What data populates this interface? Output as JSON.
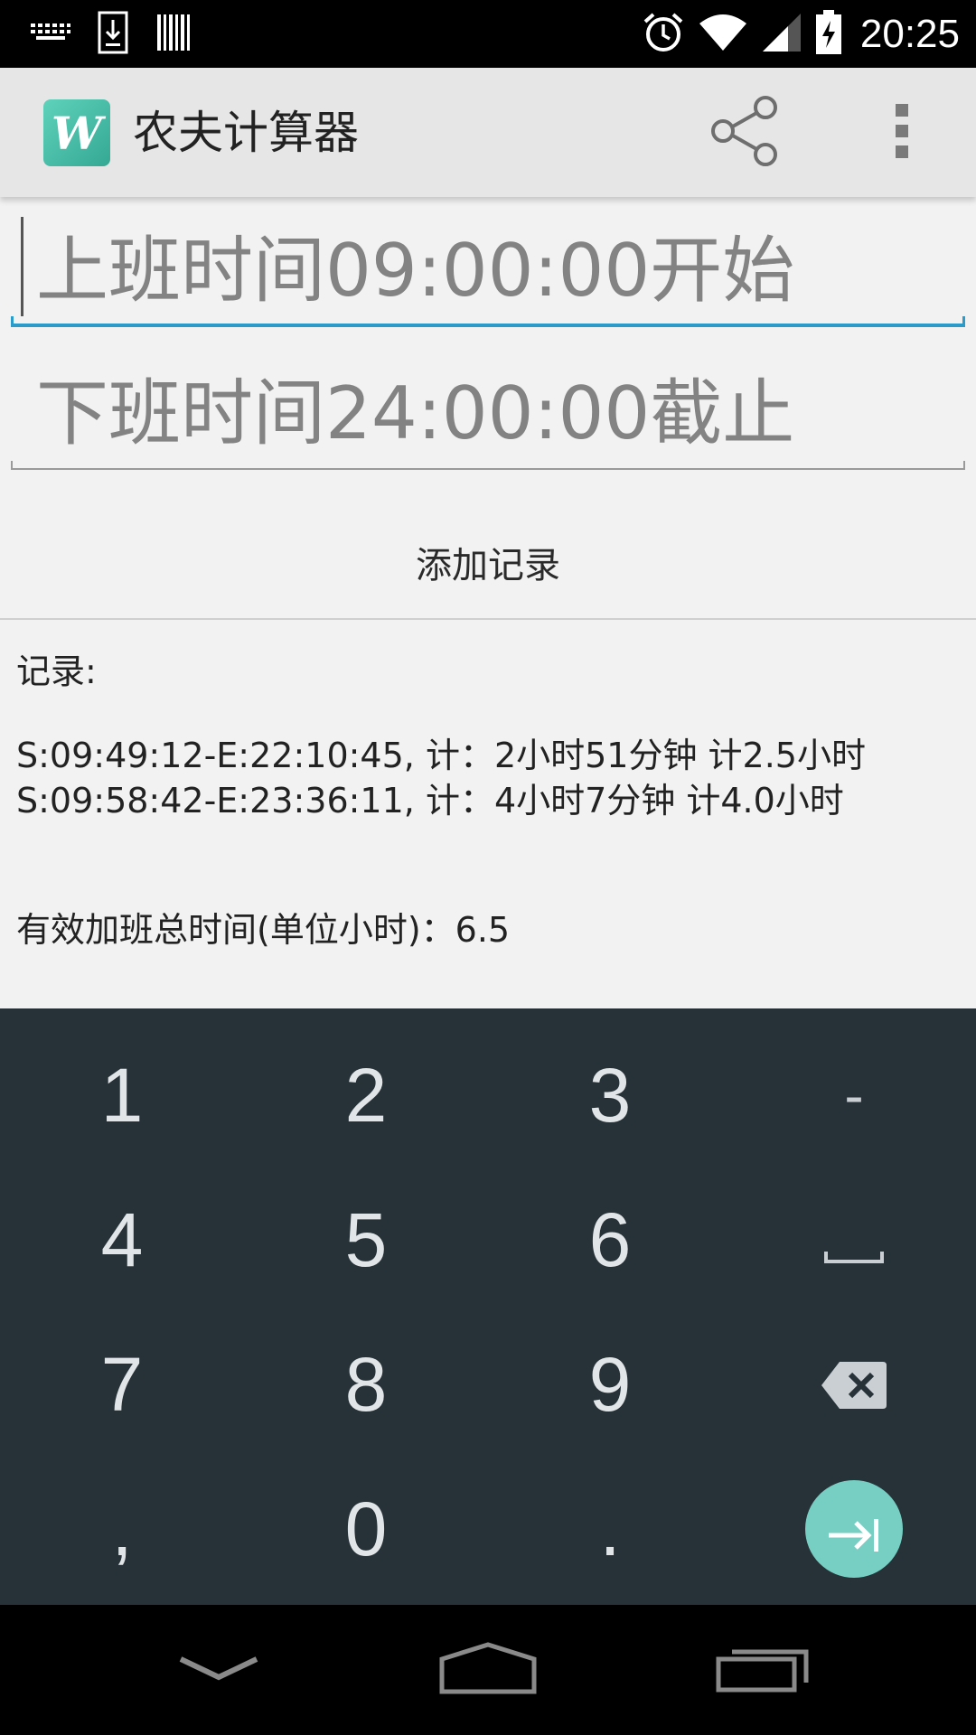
{
  "status_bar": {
    "time": "20:25",
    "left_icons": [
      "keyboard-icon",
      "download-icon",
      "barcode-icon"
    ],
    "right_icons": [
      "alarm-icon",
      "wifi-icon",
      "signal-icon",
      "battery-charging-icon"
    ]
  },
  "action_bar": {
    "title": "农夫计算器",
    "app_icon_letter": "W",
    "actions": [
      "share-icon",
      "overflow-menu-icon"
    ]
  },
  "form": {
    "start_field": {
      "placeholder": "上班时间09:00:00开始",
      "focused": true
    },
    "end_field": {
      "placeholder": "下班时间24:00:00截止"
    },
    "add_button_label": "添加记录"
  },
  "records": {
    "label": "记录:",
    "lines": [
      "S:09:49:12-E:22:10:45, 计：2小时51分钟 计2.5小时",
      "S:09:58:42-E:23:36:11, 计：4小时7分钟 计4.0小时"
    ],
    "total": "有效加班总时间(单位小时)：6.5"
  },
  "keyboard": {
    "rows": [
      [
        "1",
        "2",
        "3",
        "-"
      ],
      [
        "4",
        "5",
        "6",
        "space-key-icon"
      ],
      [
        "7",
        "8",
        "9",
        "backspace-icon"
      ],
      [
        ",",
        "0",
        ".",
        "next-arrow-icon"
      ]
    ],
    "accent_color": "#77cfc3",
    "background_color": "#263238"
  },
  "nav_bar": {
    "buttons": [
      "hide-keyboard-icon",
      "home-icon",
      "recent-apps-icon"
    ]
  },
  "colors": {
    "focus_underline": "#2b9bc9",
    "app_icon": "#4fc3ab"
  }
}
